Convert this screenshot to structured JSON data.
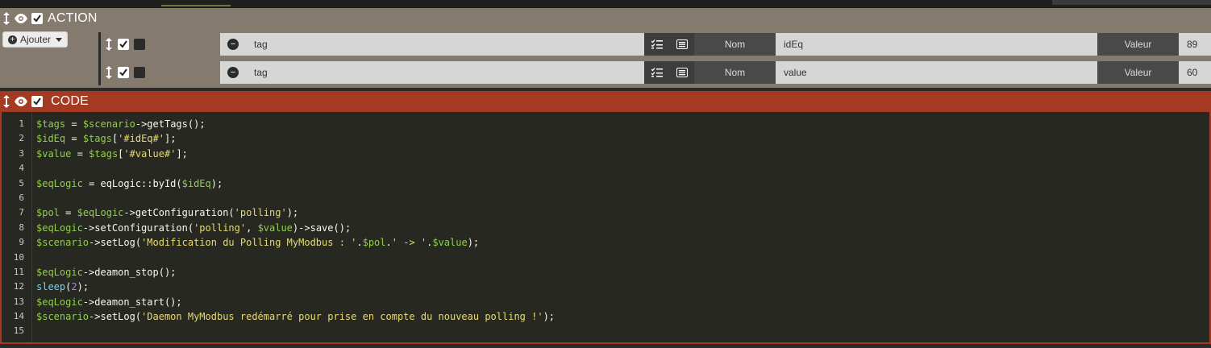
{
  "action": {
    "title": "ACTION",
    "add_label": "Ajouter",
    "rows": [
      {
        "type": "tag",
        "nom_label": "Nom",
        "nom_value": "idEq",
        "valeur_label": "Valeur",
        "valeur_value": "89"
      },
      {
        "type": "tag",
        "nom_label": "Nom",
        "nom_value": "value",
        "valeur_label": "Valeur",
        "valeur_value": "60"
      }
    ]
  },
  "code": {
    "title": "CODE",
    "line_numbers": [
      "1",
      "2",
      "3",
      "4",
      "5",
      "6",
      "7",
      "8",
      "9",
      "10",
      "11",
      "12",
      "13",
      "14",
      "15"
    ],
    "lines": [
      "$tags = $scenario->getTags();",
      "$idEq = $tags['#idEq#'];",
      "$value = $tags['#value#'];",
      "",
      "$eqLogic = eqLogic::byId($idEq);",
      "",
      "$pol = $eqLogic->getConfiguration('polling');",
      "$eqLogic->setConfiguration('polling', $value)->save();",
      "$scenario->setLog('Modification du Polling MyModbus : '.$pol.' -> '.$value);",
      "",
      "$eqLogic->deamon_stop();",
      "sleep(2);",
      "$eqLogic->deamon_start();",
      "$scenario->setLog('Daemon MyModbus redémarré pour prise en compte du nouveau polling !');",
      ""
    ]
  },
  "colors": {
    "action_header": "#847a6e",
    "code_header": "#a33a21",
    "editor_bg": "#272822",
    "variable": "#8fd04a",
    "string": "#e6db74"
  }
}
